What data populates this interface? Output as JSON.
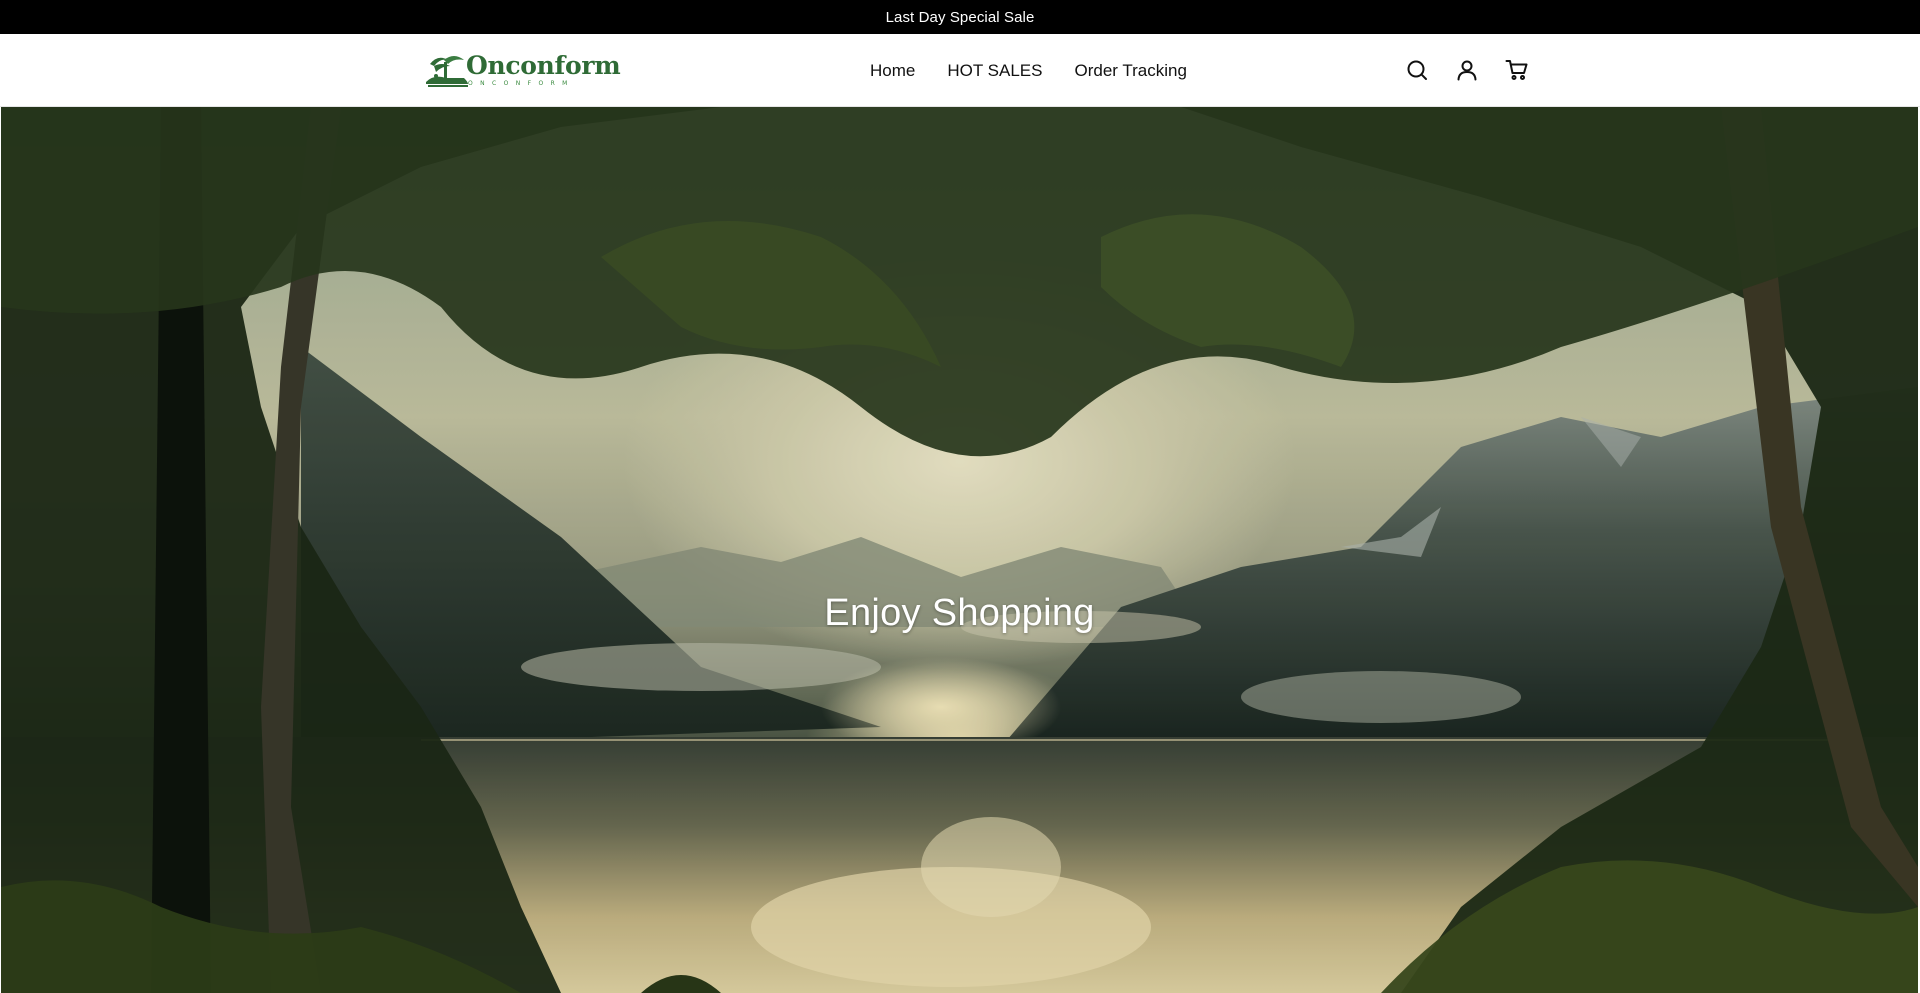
{
  "announcement": {
    "text": "Last Day Special Sale"
  },
  "logo": {
    "name": "Onconform",
    "subtext": "ONCONFORM"
  },
  "nav": [
    {
      "label": "Home"
    },
    {
      "label": "HOT SALES"
    },
    {
      "label": "Order Tracking"
    }
  ],
  "header_icons": [
    "search-icon",
    "account-icon",
    "cart-icon"
  ],
  "hero": {
    "title": "Enjoy Shopping"
  },
  "colors": {
    "brand": "#2f6b36",
    "announcement_bg": "#000000",
    "header_bg": "#ffffff"
  }
}
